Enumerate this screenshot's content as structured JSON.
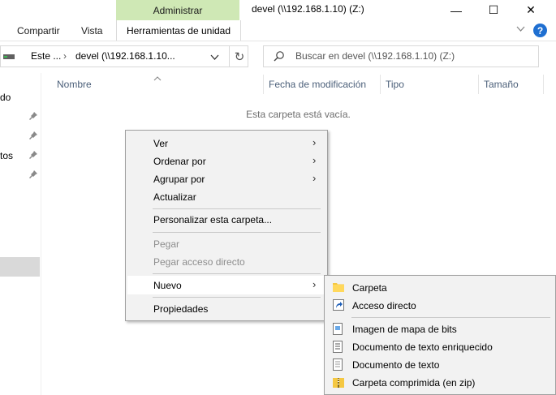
{
  "titlebar": {
    "context_tab": "Administrar",
    "title": "devel (\\\\192.168.1.10) (Z:)",
    "minimize": "—",
    "maximize": "☐",
    "close": "✕"
  },
  "ribbon": {
    "tabs": [
      "Compartir",
      "Vista"
    ],
    "active_tab": "Herramientas de unidad",
    "collapse_icon": "chevron-down-icon",
    "help": "?"
  },
  "address": {
    "crumb1": "Este ...",
    "separator": "›",
    "crumb2": "devel (\\\\192.168.1.10...",
    "dropdown": "⌄",
    "refresh": "↻"
  },
  "search": {
    "placeholder": "Buscar en devel (\\\\192.168.1.10) (Z:)"
  },
  "nav": {
    "items": [
      "do",
      "tos"
    ]
  },
  "columns": [
    "Nombre",
    "Fecha de modificación",
    "Tipo",
    "Tamaño"
  ],
  "empty_message": "Esta carpeta está vacía.",
  "context_menu": {
    "ver": "Ver",
    "ordenar": "Ordenar por",
    "agrupar": "Agrupar por",
    "actualizar": "Actualizar",
    "personalizar": "Personalizar esta carpeta...",
    "pegar": "Pegar",
    "pegar_acceso": "Pegar acceso directo",
    "nuevo": "Nuevo",
    "propiedades": "Propiedades"
  },
  "submenu": {
    "carpeta": "Carpeta",
    "acceso": "Acceso directo",
    "bitmap": "Imagen de mapa de bits",
    "rtf": "Documento de texto enriquecido",
    "txt": "Documento de texto",
    "zip": "Carpeta comprimida (en zip)"
  }
}
